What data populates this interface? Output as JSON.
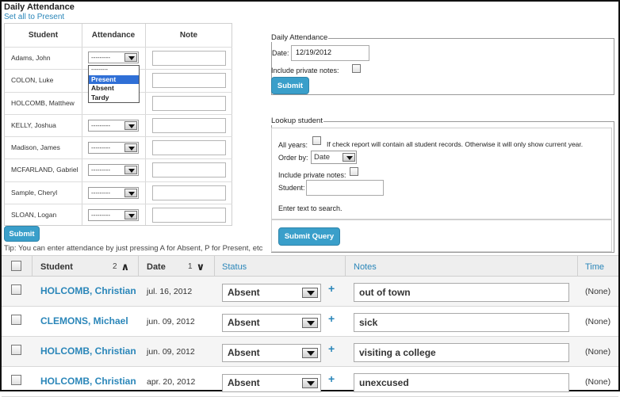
{
  "daily_attendance_title": "Daily Attendance",
  "set_all_link": "Set all to Present",
  "grid": {
    "headers": {
      "student": "Student",
      "attendance": "Attendance",
      "note": "Note"
    },
    "students": [
      "Adams, John",
      "COLON, Luke",
      "HOLCOMB, Matthew",
      "KELLY, Joshua",
      "Madison, James",
      "MCFARLAND, Gabriel",
      "Sample, Cheryl",
      "SLOAN, Logan"
    ],
    "select_default": "---------",
    "dropdown_options": [
      "---------",
      "Present",
      "Absent",
      "Tardy"
    ],
    "dropdown_highlighted": "Present",
    "submit_label": "Submit"
  },
  "tip": "Tip: You can enter attendance by just pressing A for Absent, P for Present, etc",
  "daily_panel": {
    "legend": "Daily Attendance",
    "date_label": "Date:",
    "date_value": "12/19/2012",
    "private_notes_label": "Include private notes:",
    "submit_label": "Submit"
  },
  "lookup_panel": {
    "legend": "Lookup student",
    "all_years_label": "All years:",
    "all_years_hint": "If check report will contain all student records. Otherwise it will only show current year.",
    "order_by_label": "Order by:",
    "order_by_value": "Date",
    "private_notes_label": "Include private notes:",
    "student_label": "Student:",
    "search_hint": "Enter text to search.",
    "submit_label": "Submit Query"
  },
  "records": {
    "headers": {
      "student": "Student",
      "student_sort": "2",
      "date": "Date",
      "date_sort": "1",
      "status": "Status",
      "notes": "Notes",
      "time": "Time"
    },
    "rows": [
      {
        "student": "HOLCOMB, Christian",
        "date": "jul. 16, 2012",
        "status": "Absent",
        "note": "out of town",
        "time": "(None)"
      },
      {
        "student": "CLEMONS, Michael",
        "date": "jun. 09, 2012",
        "status": "Absent",
        "note": "sick",
        "time": "(None)"
      },
      {
        "student": "HOLCOMB, Christian",
        "date": "jun. 09, 2012",
        "status": "Absent",
        "note": "visiting a college",
        "time": "(None)"
      },
      {
        "student": "HOLCOMB, Christian",
        "date": "apr. 20, 2012",
        "status": "Absent",
        "note": "unexcused",
        "time": "(None)"
      }
    ]
  },
  "colors": {
    "link": "#2a86b9",
    "button": "#3a9fca",
    "highlight": "#2f6fd6"
  }
}
